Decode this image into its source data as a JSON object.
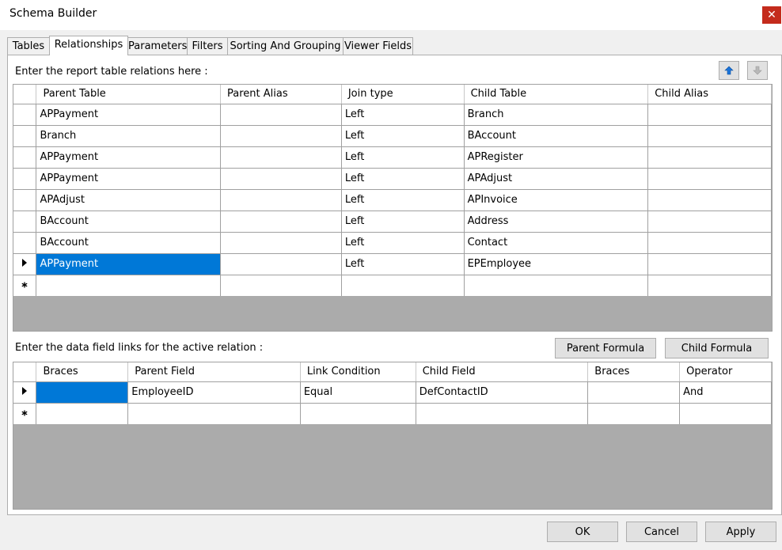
{
  "window": {
    "title": "Schema Builder",
    "close_glyph": "✕"
  },
  "tabs": [
    {
      "label": "Tables",
      "active": false
    },
    {
      "label": "Relationships",
      "active": true
    },
    {
      "label": "Parameters",
      "active": false
    },
    {
      "label": "Filters",
      "active": false
    },
    {
      "label": "Sorting And Grouping",
      "active": false
    },
    {
      "label": "Viewer Fields",
      "active": false
    }
  ],
  "relations": {
    "label": "Enter the report table relations here :",
    "columns": [
      "Parent Table",
      "Parent Alias",
      "Join type",
      "Child Table",
      "Child Alias"
    ],
    "rows": [
      [
        "APPayment",
        "",
        "Left",
        "Branch",
        ""
      ],
      [
        "Branch",
        "",
        "Left",
        "BAccount",
        ""
      ],
      [
        "APPayment",
        "",
        "Left",
        "APRegister",
        ""
      ],
      [
        "APPayment",
        "",
        "Left",
        "APAdjust",
        ""
      ],
      [
        "APAdjust",
        "",
        "Left",
        "APInvoice",
        ""
      ],
      [
        "BAccount",
        "",
        "Left",
        "Address",
        ""
      ],
      [
        "BAccount",
        "",
        "Left",
        "Contact",
        ""
      ],
      [
        "APPayment",
        "",
        "Left",
        "EPEmployee",
        ""
      ]
    ],
    "current_row": 7,
    "move_up_icon": "arrow-up-icon",
    "move_down_icon": "arrow-down-icon"
  },
  "links": {
    "label": "Enter the data field links for the active relation :",
    "parent_formula_label": "Parent Formula",
    "child_formula_label": "Child Formula",
    "columns": [
      "Braces",
      "Parent Field",
      "Link Condition",
      "Child Field",
      "Braces",
      "Operator"
    ],
    "rows": [
      [
        "",
        "EmployeeID",
        "Equal",
        "DefContactID",
        "",
        "And"
      ]
    ],
    "current_row": 0
  },
  "footer": {
    "ok_label": "OK",
    "cancel_label": "Cancel",
    "apply_label": "Apply"
  },
  "colors": {
    "selection": "#0078d7",
    "close": "#c42b1c",
    "grid_empty": "#ababab"
  }
}
